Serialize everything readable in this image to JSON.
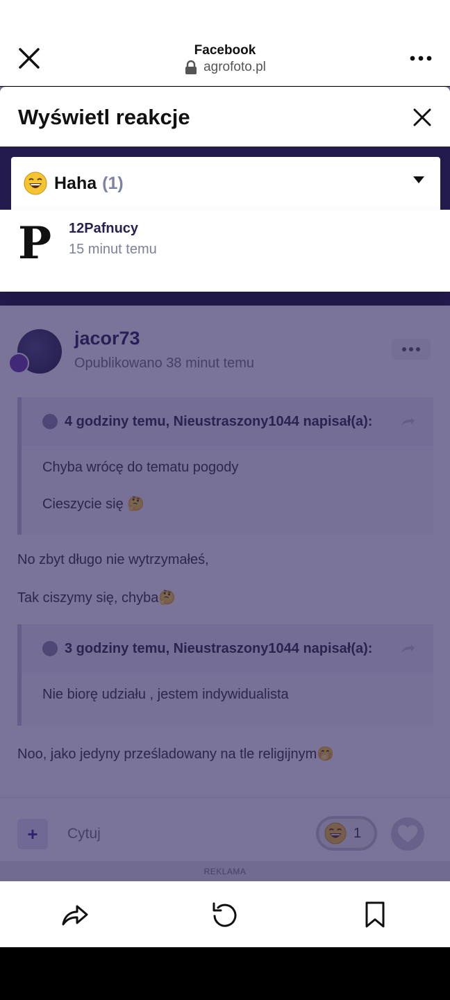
{
  "browser": {
    "title": "Facebook",
    "url": "agrofoto.pl",
    "close_icon": "close-icon",
    "more_icon": "more-horizontal-icon"
  },
  "modal": {
    "title": "Wyświetl reakcje",
    "selected_reaction": {
      "label": "Haha",
      "count": "(1)",
      "icon": "laughing-emoji-icon"
    },
    "reactors": [
      {
        "name": "12Pafnucy",
        "time": "15 minut temu",
        "avatar_letter": "P"
      }
    ]
  },
  "post": {
    "author": "jacor73",
    "published": "Opublikowano 38 minut temu",
    "quotes": [
      {
        "header": "4 godziny temu, Nieustraszony1044 napisał(a):",
        "lines": [
          "Chyba wrócę do tematu pogody",
          "Cieszycie się 🤔"
        ]
      },
      {
        "header": "3 godziny temu, Nieustraszony1044 napisał(a):",
        "lines": [
          "Nie biorę udziału , jestem indywidualista"
        ]
      }
    ],
    "text_1": "No zbyt długo nie wytrzymałeś,",
    "text_2": "Tak ciszymy się, chyba🤔",
    "text_3": "Noo, jako jedyny prześladowany na tle religijnym🤭",
    "footer": {
      "plus": "+",
      "quote_label": "Cytuj",
      "reaction_count": "1"
    },
    "ad_label": "REKLAMA"
  },
  "colors": {
    "brand_dark": "#1c1438",
    "accent": "#2a2050",
    "overlay": "#281e5a"
  }
}
